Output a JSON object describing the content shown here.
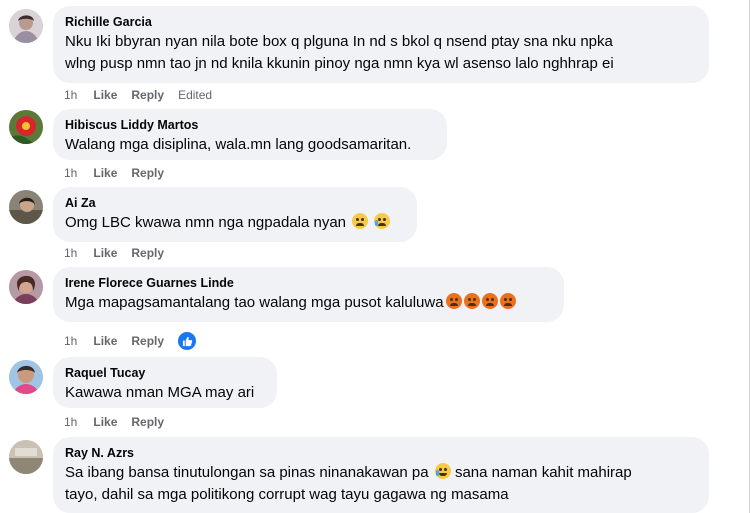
{
  "comments": [
    {
      "author": "Richille Garcia",
      "text_line1": "Nku Iki bbyran nyan nila bote box q plguna In nd s bkol q nsend ptay sna nku npka",
      "text_line2": "wlng pusp nmn tao jn nd knila kkunin pinoy nga nmn kya wl asenso lalo nghhrap ei",
      "time": "1h",
      "like": "Like",
      "reply": "Reply",
      "edited": "Edited",
      "avatar_icon": "profile-photo"
    },
    {
      "author": "Hibiscus Liddy Martos",
      "text": "Walang mga disiplina, wala.mn lang goodsamaritan.",
      "time": "1h",
      "like": "Like",
      "reply": "Reply",
      "avatar_icon": "profile-photo"
    },
    {
      "author": "Ai Za",
      "text": "Omg LBC kwawa nmn nga ngpadala nyan",
      "time": "1h",
      "like": "Like",
      "reply": "Reply",
      "emojis": [
        "pensive-face-emoji",
        "crying-face-emoji"
      ],
      "avatar_icon": "profile-photo"
    },
    {
      "author": "Irene Florece Guarnes Linde",
      "text": "Mga mapagsamantalang tao walang mga pusot kaluluwa",
      "time": "1h",
      "like": "Like",
      "reply": "Reply",
      "emojis": [
        "angry-face-emoji",
        "angry-face-emoji",
        "angry-face-emoji",
        "angry-face-emoji"
      ],
      "reaction_icon": "thumbs-up-reaction-icon",
      "avatar_icon": "profile-photo"
    },
    {
      "author": "Raquel Tucay",
      "text": "Kawawa nman MGA may ari",
      "time": "1h",
      "like": "Like",
      "reply": "Reply",
      "avatar_icon": "profile-photo"
    },
    {
      "author": "Ray N. Azrs",
      "text_line1_a": "Sa ibang bansa tinutulongan sa pinas ninanakawan pa",
      "text_line1_b": "sana naman kahit mahirap",
      "text_line2": "tayo, dahil sa mga politikong corrupt wag tayu gagawa ng masama",
      "emojis": [
        "laughing-crying-face-emoji"
      ],
      "avatar_icon": "profile-photo"
    }
  ],
  "colors": {
    "bubble_bg": "#f0f2f5",
    "text": "#050505",
    "meta": "#65676b",
    "like_badge": "#1877f2"
  }
}
